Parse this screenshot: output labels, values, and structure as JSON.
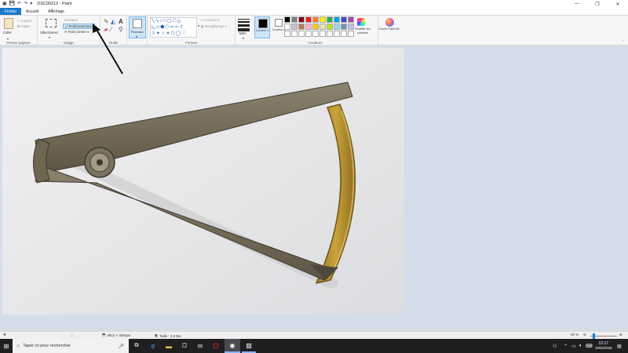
{
  "titlebar": {
    "title": "DSC00212 - Paint",
    "quick_access": [
      "save-icon",
      "undo-icon",
      "redo-icon",
      "customize-icon"
    ],
    "minimize": "—",
    "maximize": "❐",
    "close": "✕"
  },
  "tabs": {
    "file": "Fichier",
    "home": "Accueil",
    "view": "Affichage"
  },
  "ribbon": {
    "clipboard": {
      "label": "Presse-papiers",
      "paste": "Coller",
      "cut": "Couper",
      "copy": "Copier"
    },
    "image": {
      "label": "Image",
      "select": "Sélectionner",
      "crop": "Rogner",
      "resize": "Redimensionner",
      "rotate": "Faire pivoter"
    },
    "tools": {
      "label": "Outils"
    },
    "brushes": {
      "label": "Pinceaux"
    },
    "shapes": {
      "label": "Formes",
      "outline": "Contour",
      "fill": "Remplissage"
    },
    "size": {
      "label": "Taille"
    },
    "colors": {
      "label": "Couleurs",
      "color1": "Couleur 1",
      "color2": "Couleur 2",
      "edit": "Modifier les couleurs",
      "color1_value": "#000000",
      "color2_value": "#ffffff",
      "palette_row1": [
        "#000000",
        "#7f7f7f",
        "#880015",
        "#ed1c24",
        "#ff7f27",
        "#fff200",
        "#22b14c",
        "#00a2e8",
        "#3f48cc",
        "#a349a4"
      ],
      "palette_row2": [
        "#ffffff",
        "#c3c3c3",
        "#b97a57",
        "#ffaec9",
        "#ffc90e",
        "#efe4b0",
        "#b5e61d",
        "#99d9ea",
        "#7092be",
        "#c8bfe7"
      ],
      "palette_row3": [
        "#ffffff",
        "#ffffff",
        "#ffffff",
        "#ffffff",
        "#ffffff",
        "#ffffff",
        "#ffffff",
        "#ffffff",
        "#ffffff",
        "#ffffff"
      ]
    },
    "paint3d": {
      "label": "Ouvrir Paint 3D"
    }
  },
  "statusbar": {
    "dimensions": "4912 × 3264px",
    "filesize": "Taille : 2,8 Mo",
    "zoom": "25 %",
    "zoom_level": 0.25
  },
  "taskbar": {
    "search_placeholder": "Taper ici pour rechercher",
    "time": "12:17",
    "date": "19/02/2018"
  }
}
